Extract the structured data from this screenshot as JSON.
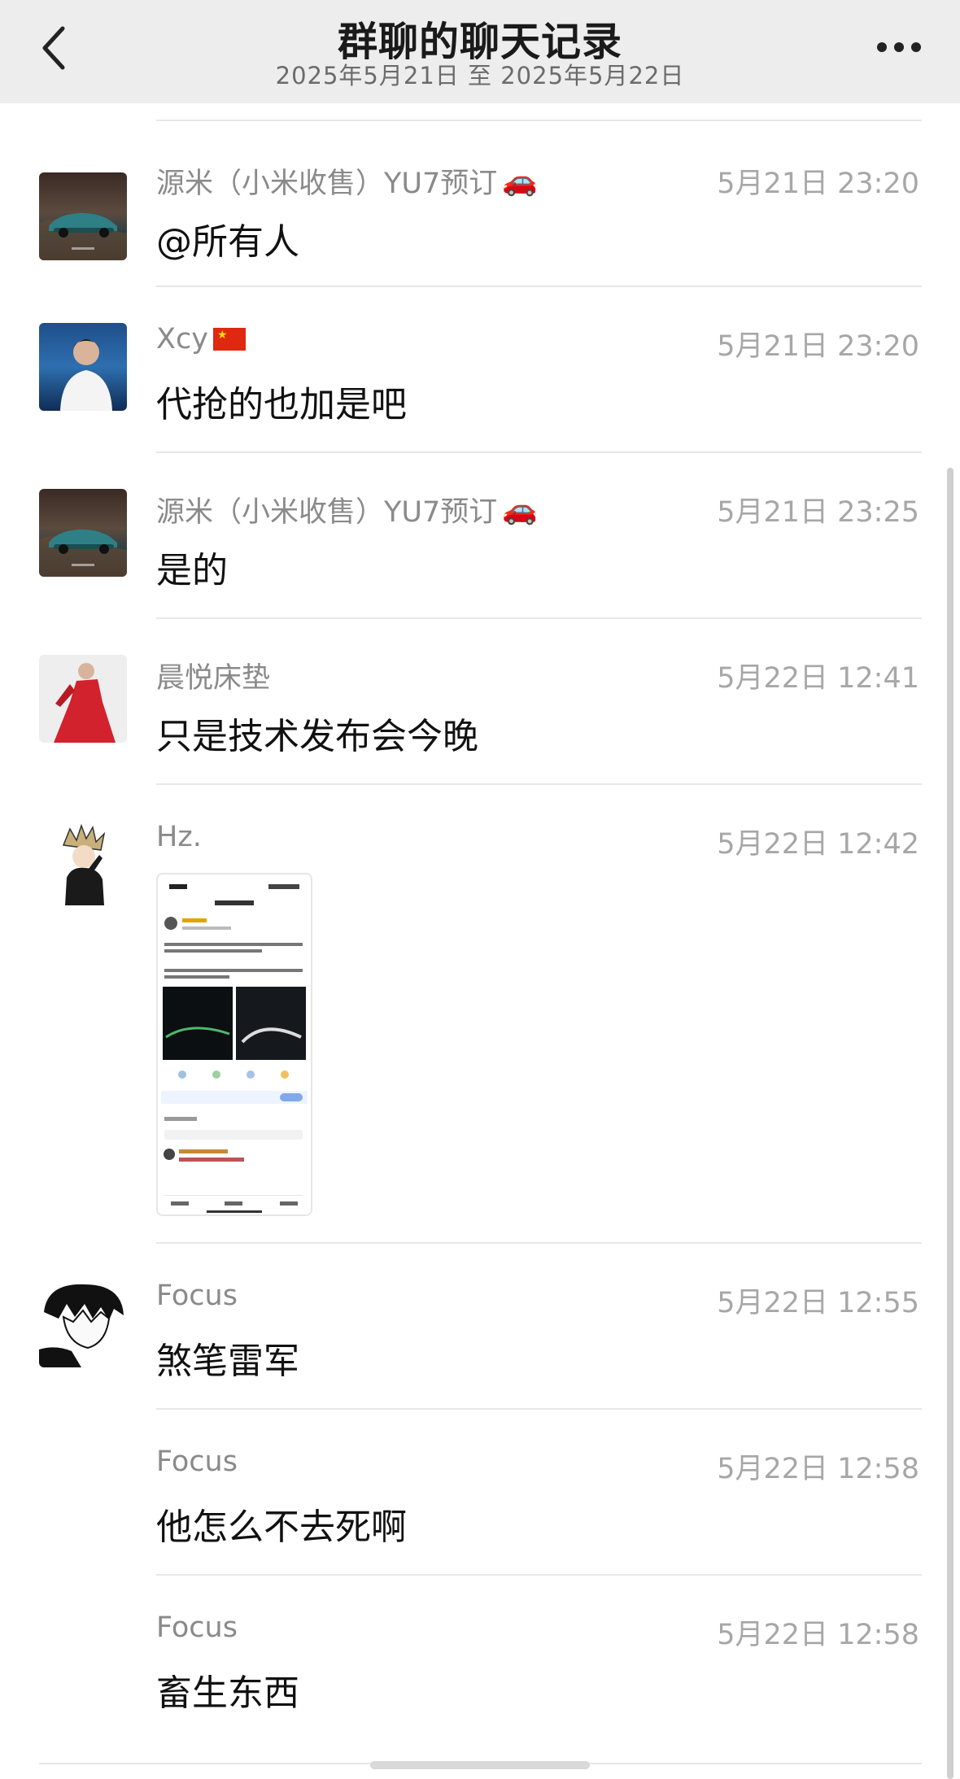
{
  "header": {
    "title": "群聊的聊天记录",
    "subtitle": "2025年5月21日 至 2025年5月22日",
    "back_icon": "chevron-left-icon",
    "more_icon": "more-dots-icon"
  },
  "messages": [
    {
      "sender": "源米（小米收售）YU7预订",
      "sender_emoji": "🚗",
      "time": "5月21日 23:20",
      "text": "@所有人"
    },
    {
      "sender": "Xcy",
      "sender_emoji": "🇨🇳",
      "time": "5月21日 23:20",
      "text": "代抢的也加是吧"
    },
    {
      "sender": "源米（小米收售）YU7预订",
      "sender_emoji": "🚗",
      "time": "5月21日 23:25",
      "text": "是的"
    },
    {
      "sender": "晨悦床垫",
      "time": "5月22日 12:41",
      "text": "只是技术发布会今晚"
    },
    {
      "sender": "Hz.",
      "time": "5月22日 12:42",
      "image": "screenshot-image"
    },
    {
      "sender": "Focus",
      "time": "5月22日 12:55",
      "text": "煞笔雷军"
    },
    {
      "sender": "Focus",
      "time": "5月22日 12:58",
      "text": "他怎么不去死啊"
    },
    {
      "sender": "Focus",
      "time": "5月22日 12:58",
      "text": "畜生东西"
    }
  ],
  "colors": {
    "header_bg": "#ededed",
    "divider": "#e8e8e8",
    "sender_text": "#8a8a8a",
    "time_text": "#a7a7a7",
    "message_text": "#111111"
  }
}
